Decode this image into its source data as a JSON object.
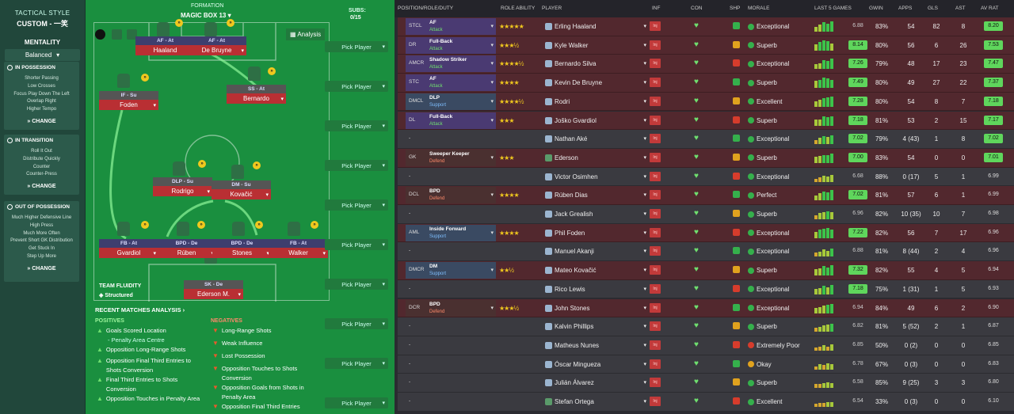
{
  "tactics": {
    "style_label": "TACTICAL STYLE",
    "custom_label": "CUSTOM - 一笑",
    "mentality_label": "MENTALITY",
    "mentality_value": "Balanced",
    "in_possession": {
      "title": "IN POSSESSION",
      "items": [
        "Shorter Passing",
        "Low Crosses",
        "Focus Play Down The Left",
        "Overlap Right",
        "Higher Tempo"
      ],
      "change": "CHANGE"
    },
    "in_transition": {
      "title": "IN TRANSITION",
      "items": [
        "Roll It Out",
        "Distribute Quickly",
        "Counter",
        "Counter-Press"
      ],
      "change": "CHANGE"
    },
    "out_of_possession": {
      "title": "OUT OF POSSESSION",
      "items": [
        "Much Higher Defensive Line",
        "High Press",
        "Much More Often",
        "Prevent Short GK Distribution",
        "Get Stuck In",
        "Step Up More"
      ],
      "change": "CHANGE"
    }
  },
  "pitch": {
    "formation_label": "FORMATION",
    "formation_name": "MAGIC BOX 13",
    "subs_label": "SUBS:",
    "subs_count": "0/15",
    "analysis_label": "Analysis",
    "pick_label": "Pick Player",
    "players": [
      {
        "role": "AF - At",
        "name": "Haaland"
      },
      {
        "role": "AF - At",
        "name": "De Bruyne"
      },
      {
        "role": "IF - Su",
        "name": "Foden"
      },
      {
        "role": "SS - At",
        "name": "Bernardo"
      },
      {
        "role": "DLP - Su",
        "name": "Rodrigo"
      },
      {
        "role": "DM - Su",
        "name": "Kovačić"
      },
      {
        "role": "FB - At",
        "name": "Gvardiol"
      },
      {
        "role": "BPD - De",
        "name": "Rúben"
      },
      {
        "role": "BPD - De",
        "name": "Stones"
      },
      {
        "role": "FB - At",
        "name": "Walker"
      },
      {
        "role": "SK - De",
        "name": "Ederson M."
      }
    ],
    "fluidity_label": "TEAM FLUIDITY",
    "fluidity_value": "Structured",
    "recent_label": "RECENT MATCHES ANALYSIS ›",
    "positives_label": "POSITIVES",
    "negatives_label": "NEGATIVES",
    "positives": [
      "Goals Scored Location",
      "- Penalty Area Centre",
      "Opposition Long-Range Shots",
      "Opposition Final Third Entries to Shots Conversion",
      "Final Third Entries to Shots Conversion",
      "Opposition Touches in Penalty Area"
    ],
    "negatives": [
      "Long-Range Shots",
      "Weak Influence",
      "Lost Possession",
      "Opposition Touches to Shots Conversion",
      "Opposition Goals from Shots in Penalty Area",
      "Opposition Final Third Entries"
    ]
  },
  "table": {
    "headers": [
      "POSITION/ROLE/DUTY",
      "ROLE ABILITY",
      "PLAYER",
      "INF",
      "CON",
      "SHP",
      "MORALE",
      "LAST 5 GAMES",
      "GWIN",
      "APPS",
      "GLS",
      "AST",
      "AV RAT"
    ],
    "inf_text": "Inj",
    "rows": [
      {
        "pos": "STCL",
        "role": "AF",
        "duty": "Attack",
        "stars": "★★★★★",
        "name": "Erling Haaland",
        "morale": "Exceptional",
        "avg": "6.88",
        "gwin": "83%",
        "apps": "54",
        "gls": "82",
        "ast": "8",
        "rat": "8.20",
        "bg": "red",
        "last5": [
          0.5,
          0.7,
          0.9,
          0.8,
          1.0
        ]
      },
      {
        "pos": "DR",
        "role": "Full-Back",
        "duty": "Attack",
        "stars": "★★★½",
        "name": "Kyle Walker",
        "morale": "Superb",
        "avg": "8.14",
        "gwin": "80%",
        "apps": "56",
        "gls": "6",
        "ast": "26",
        "rat": "7.53",
        "bg": "red",
        "last5": [
          0.6,
          0.8,
          1.0,
          0.9,
          0.7
        ]
      },
      {
        "pos": "AMCR",
        "role": "Shadow Striker",
        "duty": "Attack",
        "stars": "★★★★½",
        "name": "Bernardo Silva",
        "morale": "Exceptional",
        "avg": "7.26",
        "gwin": "79%",
        "apps": "48",
        "gls": "17",
        "ast": "23",
        "rat": "7.47",
        "bg": "red",
        "last5": [
          0.5,
          0.6,
          0.9,
          0.8,
          1.0
        ]
      },
      {
        "pos": "STC",
        "role": "AF",
        "duty": "Attack",
        "stars": "★★★★",
        "name": "Kevin De Bruyne",
        "morale": "Superb",
        "avg": "7.49",
        "gwin": "80%",
        "apps": "49",
        "gls": "27",
        "ast": "22",
        "rat": "7.37",
        "bg": "red",
        "last5": [
          0.7,
          0.8,
          1.0,
          0.9,
          0.8
        ]
      },
      {
        "pos": "DMCL",
        "role": "DLP",
        "duty": "Support",
        "stars": "★★★★½",
        "name": "Rodri",
        "morale": "Excellent",
        "avg": "7.28",
        "gwin": "80%",
        "apps": "54",
        "gls": "8",
        "ast": "7",
        "rat": "7.18",
        "bg": "red",
        "last5": [
          0.5,
          0.7,
          0.8,
          0.9,
          1.0
        ]
      },
      {
        "pos": "DL",
        "role": "Full-Back",
        "duty": "Attack",
        "stars": "★★★",
        "name": "Joško Gvardiol",
        "morale": "Superb",
        "avg": "7.18",
        "gwin": "81%",
        "apps": "53",
        "gls": "2",
        "ast": "15",
        "rat": "7.17",
        "bg": "red",
        "last5": [
          0.6,
          0.6,
          0.9,
          0.8,
          0.9
        ]
      },
      {
        "pos": "-",
        "role": "",
        "duty": "",
        "stars": "",
        "name": "Nathan Aké",
        "morale": "Exceptional",
        "avg": "7.02",
        "gwin": "79%",
        "apps": "4 (43)",
        "gls": "1",
        "ast": "8",
        "rat": "7.02",
        "bg": "plain",
        "last5": [
          0.4,
          0.6,
          0.8,
          0.7,
          0.9
        ]
      },
      {
        "pos": "GK",
        "role": "Sweeper Keeper",
        "duty": "Defend",
        "stars": "★★★",
        "name": "Ederson",
        "morale": "Superb",
        "avg": "7.00",
        "gwin": "83%",
        "apps": "54",
        "gls": "0",
        "ast": "0",
        "rat": "7.01",
        "bg": "red",
        "last5": [
          0.6,
          0.7,
          0.8,
          0.8,
          0.9
        ]
      },
      {
        "pos": "-",
        "role": "",
        "duty": "",
        "stars": "",
        "name": "Victor Osimhen",
        "morale": "Exceptional",
        "avg": "6.68",
        "gwin": "88%",
        "apps": "0 (17)",
        "gls": "5",
        "ast": "1",
        "rat": "6.99",
        "bg": "plain",
        "last5": [
          0.3,
          0.4,
          0.6,
          0.5,
          0.7
        ]
      },
      {
        "pos": "DCL",
        "role": "BPD",
        "duty": "Defend",
        "stars": "★★★★",
        "name": "Rúben Dias",
        "morale": "Perfect",
        "avg": "7.02",
        "gwin": "81%",
        "apps": "57",
        "gls": "6",
        "ast": "1",
        "rat": "6.99",
        "bg": "red",
        "last5": [
          0.5,
          0.7,
          0.9,
          0.8,
          1.0
        ]
      },
      {
        "pos": "-",
        "role": "",
        "duty": "",
        "stars": "",
        "name": "Jack Grealish",
        "morale": "Superb",
        "avg": "6.96",
        "gwin": "82%",
        "apps": "10 (35)",
        "gls": "10",
        "ast": "7",
        "rat": "6.98",
        "bg": "plain",
        "last5": [
          0.4,
          0.6,
          0.7,
          0.8,
          0.7
        ]
      },
      {
        "pos": "AML",
        "role": "Inside Forward",
        "duty": "Support",
        "stars": "★★★★",
        "name": "Phil Foden",
        "morale": "Exceptional",
        "avg": "7.22",
        "gwin": "82%",
        "apps": "56",
        "gls": "7",
        "ast": "17",
        "rat": "6.96",
        "bg": "red",
        "last5": [
          0.6,
          0.8,
          0.9,
          1.0,
          0.8
        ]
      },
      {
        "pos": "-",
        "role": "",
        "duty": "",
        "stars": "",
        "name": "Manuel Akanji",
        "morale": "Exceptional",
        "avg": "6.88",
        "gwin": "81%",
        "apps": "8 (44)",
        "gls": "2",
        "ast": "4",
        "rat": "6.96",
        "bg": "plain",
        "last5": [
          0.4,
          0.5,
          0.7,
          0.6,
          0.8
        ]
      },
      {
        "pos": "DMCR",
        "role": "DM",
        "duty": "Support",
        "stars": "★★½",
        "name": "Mateo Kovačić",
        "morale": "Superb",
        "avg": "7.32",
        "gwin": "82%",
        "apps": "55",
        "gls": "4",
        "ast": "5",
        "rat": "6.94",
        "bg": "red",
        "last5": [
          0.6,
          0.7,
          0.9,
          0.8,
          1.0
        ]
      },
      {
        "pos": "-",
        "role": "",
        "duty": "",
        "stars": "",
        "name": "Rico Lewis",
        "morale": "Exceptional",
        "avg": "7.18",
        "gwin": "75%",
        "apps": "1 (31)",
        "gls": "1",
        "ast": "5",
        "rat": "6.93",
        "bg": "plain",
        "last5": [
          0.5,
          0.6,
          0.8,
          0.7,
          0.9
        ]
      },
      {
        "pos": "DCR",
        "role": "BPD",
        "duty": "Defend",
        "stars": "★★★½",
        "name": "John Stones",
        "morale": "Exceptional",
        "avg": "6.94",
        "gwin": "84%",
        "apps": "49",
        "gls": "6",
        "ast": "2",
        "rat": "6.90",
        "bg": "red",
        "last5": [
          0.5,
          0.6,
          0.7,
          0.8,
          0.9
        ]
      },
      {
        "pos": "-",
        "role": "",
        "duty": "",
        "stars": "",
        "name": "Kalvin Phillips",
        "morale": "Superb",
        "avg": "6.82",
        "gwin": "81%",
        "apps": "5 (52)",
        "gls": "2",
        "ast": "1",
        "rat": "6.87",
        "bg": "plain",
        "last5": [
          0.4,
          0.5,
          0.6,
          0.7,
          0.8
        ]
      },
      {
        "pos": "-",
        "role": "",
        "duty": "",
        "stars": "",
        "name": "Matheus Nunes",
        "morale": "Extremely Poor",
        "avg": "6.85",
        "gwin": "50%",
        "apps": "0 (2)",
        "gls": "0",
        "ast": "0",
        "rat": "6.85",
        "bg": "plain",
        "last5": [
          0.3,
          0.4,
          0.5,
          0.4,
          0.6
        ]
      },
      {
        "pos": "-",
        "role": "",
        "duty": "",
        "stars": "",
        "name": "Óscar Mingueza",
        "morale": "Okay",
        "avg": "6.78",
        "gwin": "67%",
        "apps": "0 (3)",
        "gls": "0",
        "ast": "0",
        "rat": "6.83",
        "bg": "plain",
        "last5": [
          0.3,
          0.5,
          0.4,
          0.6,
          0.5
        ]
      },
      {
        "pos": "-",
        "role": "",
        "duty": "",
        "stars": "",
        "name": "Julián Álvarez",
        "morale": "Superb",
        "avg": "6.58",
        "gwin": "85%",
        "apps": "9 (25)",
        "gls": "3",
        "ast": "3",
        "rat": "6.80",
        "bg": "plain",
        "last5": [
          0.4,
          0.4,
          0.5,
          0.6,
          0.5
        ]
      },
      {
        "pos": "-",
        "role": "",
        "duty": "",
        "stars": "",
        "name": "Stefan Ortega",
        "morale": "Excellent",
        "avg": "6.54",
        "gwin": "33%",
        "apps": "0 (3)",
        "gls": "0",
        "ast": "0",
        "rat": "6.10",
        "bg": "plain",
        "last5": [
          0.3,
          0.4,
          0.4,
          0.5,
          0.5
        ]
      }
    ]
  },
  "colors": {
    "positive": "#6fe06f",
    "negative": "#e85a2c",
    "injury": "#c23a3a",
    "star": "#f0c81e"
  }
}
